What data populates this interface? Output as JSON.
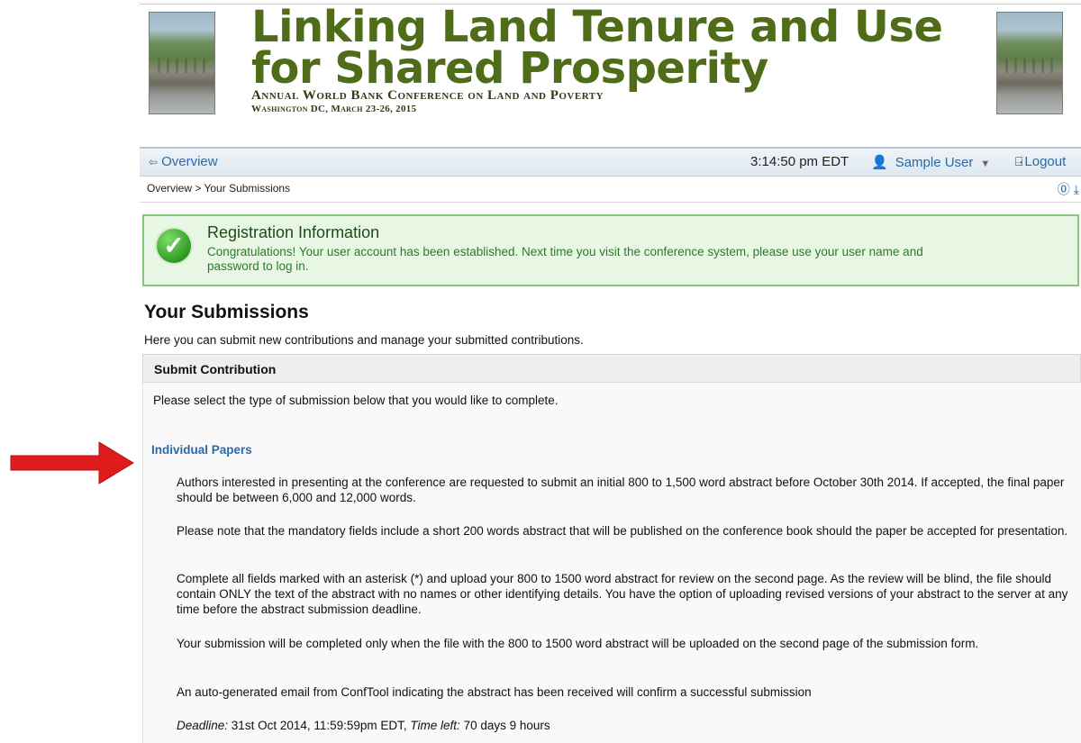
{
  "banner": {
    "title_line1": "Linking Land Tenure and Use",
    "title_line2": "for Shared Prosperity",
    "subtitle": "Annual World Bank Conference on Land and Poverty",
    "location": "Washington DC, March 23-26, 2015"
  },
  "nav": {
    "overview": "Overview",
    "time": "3:14:50 pm EDT",
    "user": "Sample User",
    "logout": "Logout"
  },
  "breadcrumb": {
    "home": "Overview",
    "separator": " > ",
    "current": "Your Submissions"
  },
  "registration": {
    "title": "Registration Information",
    "message": "Congratulations! Your user account has been established. Next time you visit the conference system, please use your user name and password to log in."
  },
  "submissions": {
    "title": "Your Submissions",
    "intro": "Here you can submit new contributions and manage your submitted contributions.",
    "section_header": "Submit Contribution",
    "select_prompt": "Please select the type of submission below that you would like to complete."
  },
  "individual_papers": {
    "link": "Individual Papers",
    "paragraphs": [
      "Authors interested in presenting at the conference are requested to submit an initial 800 to 1,500 word abstract before October 30th 2014. If accepted, the final paper should be between 6,000 and 12,000 words.",
      "Please note that the mandatory fields include a short 200 words abstract that will be published on the conference book should the paper be accepted for presentation.",
      "Complete all fields marked with an asterisk (*) and upload your 800 to 1500 word abstract for review on the second page. As the review will be blind, the file should contain ONLY the text of the abstract with no names or other identifying details. You have the option of uploading revised versions of your abstract to the server at any time before the abstract submission deadline.",
      "Your submission will be completed only when the file with the 800 to 1500 word abstract will be uploaded on the second page of the submission form.",
      "An auto-generated email from ConfTool indicating the abstract has been received will confirm a successful submission"
    ],
    "deadline_label": "Deadline:",
    "deadline_value": " 31st Oct 2014, 11:59:59pm EDT, ",
    "time_left_label": "Time left:",
    "time_left_value": " 70 days 9 hours"
  },
  "colors": {
    "banner_green": "#4f6d18",
    "link_blue": "#2a6aa8",
    "success_bg": "#e8f7e4",
    "success_border": "#86c77c",
    "arrow_red": "#e01b1b"
  }
}
